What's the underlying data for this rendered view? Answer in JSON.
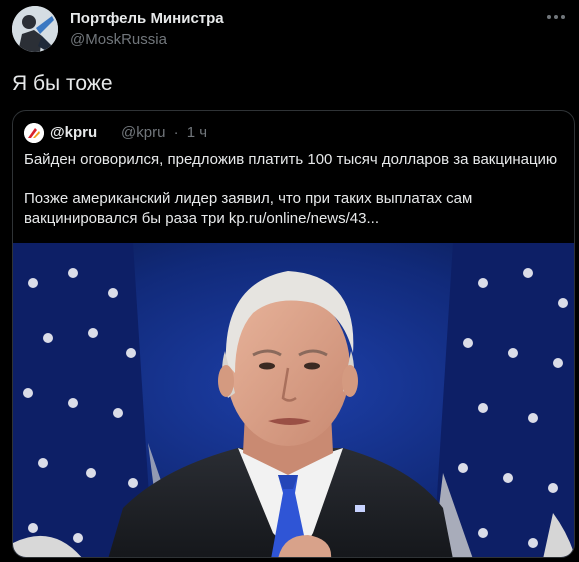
{
  "author": {
    "name": "Портфель Министра",
    "handle": "@MoskRussia"
  },
  "tweet": {
    "text": "Я бы тоже"
  },
  "quoted": {
    "name": "@kpru",
    "handle": "@kpru",
    "separator": "·",
    "time": "1 ч",
    "headline": "Байден оговорился, предложив платить 100 тысяч долларов за вакцинацию",
    "body": "Позже американский лидер заявил, что при таких выплатах сам вакцинировался бы раза три kp.ru/online/news/43..."
  },
  "icons": {
    "more": "more-horizontal-icon",
    "verified": "verified-badge-icon"
  },
  "colors": {
    "background": "#000000",
    "text": "#e7e9ea",
    "secondary": "#71767b",
    "border": "#2f3336"
  }
}
